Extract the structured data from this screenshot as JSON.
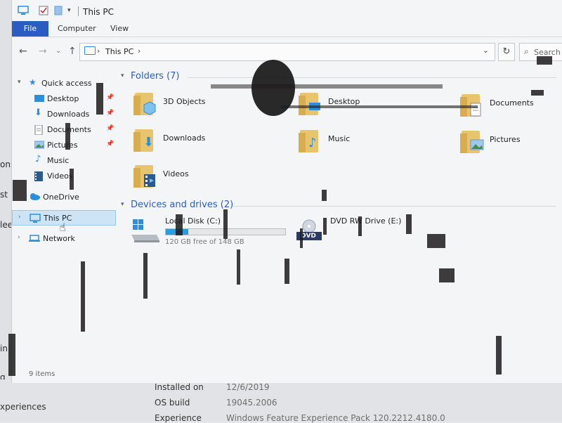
{
  "window": {
    "title": "This PC"
  },
  "ribbon": {
    "tabs": [
      "File",
      "Computer",
      "View"
    ]
  },
  "address": {
    "crumb": "This PC",
    "separator": "›",
    "search_placeholder": "Search"
  },
  "nav": {
    "back": "←",
    "forward": "→",
    "up": "↑",
    "refresh": "↻",
    "dropdown": "⌄"
  },
  "sidebar": {
    "items": [
      {
        "label": "Quick access",
        "icon": "star-icon",
        "pinned": false,
        "level": 0
      },
      {
        "label": "Desktop",
        "icon": "desktop-icon",
        "pinned": true,
        "level": 1
      },
      {
        "label": "Downloads",
        "icon": "download-icon",
        "pinned": true,
        "level": 1
      },
      {
        "label": "Documents",
        "icon": "documents-icon",
        "pinned": true,
        "level": 1
      },
      {
        "label": "Pictures",
        "icon": "pictures-icon",
        "pinned": true,
        "level": 1
      },
      {
        "label": "Music",
        "icon": "music-icon",
        "pinned": false,
        "level": 1
      },
      {
        "label": "Videos",
        "icon": "videos-icon",
        "pinned": false,
        "level": 1
      },
      {
        "label": "OneDrive",
        "icon": "cloud-icon",
        "pinned": false,
        "level": 0
      },
      {
        "label": "This PC",
        "icon": "pc-icon",
        "pinned": false,
        "level": 0,
        "selected": true
      },
      {
        "label": "Network",
        "icon": "network-icon",
        "pinned": false,
        "level": 0
      }
    ]
  },
  "main": {
    "folders_header": "Folders (7)",
    "folders": [
      {
        "label": "3D Objects",
        "badge": "cube-icon"
      },
      {
        "label": "Desktop",
        "badge": "desktop-icon"
      },
      {
        "label": "Documents",
        "badge": "documents-icon"
      },
      {
        "label": "Downloads",
        "badge": "download-icon"
      },
      {
        "label": "Music",
        "badge": "music-icon"
      },
      {
        "label": "Pictures",
        "badge": "pictures-icon"
      },
      {
        "label": "Videos",
        "badge": "videos-icon"
      }
    ],
    "drives_header": "Devices and drives (2)",
    "drives": [
      {
        "label": "Local Disk (C:)",
        "free_text": "120 GB free of 148 GB",
        "used_fraction": 0.19,
        "icon": "windows-drive-icon"
      },
      {
        "label": "DVD RW Drive (E:)",
        "icon": "dvd-icon",
        "icon_text": "DVD"
      }
    ]
  },
  "status": {
    "items": "9 items"
  },
  "background": {
    "left_fragments": [
      "ons",
      "st",
      "leep",
      "in",
      "g"
    ],
    "rows": [
      {
        "label": "Installed on",
        "value": "12/6/2019"
      },
      {
        "label": "OS build",
        "value": "19045.2006"
      },
      {
        "label": "Experience",
        "value": "Windows Feature Experience Pack 120.2212.4180.0"
      }
    ],
    "left_label": "xperiences"
  },
  "colors": {
    "accent": "#2a5cc2",
    "selection": "#cde4f7",
    "folder": "#e8c46c",
    "drive_fill": "#26a0da"
  }
}
